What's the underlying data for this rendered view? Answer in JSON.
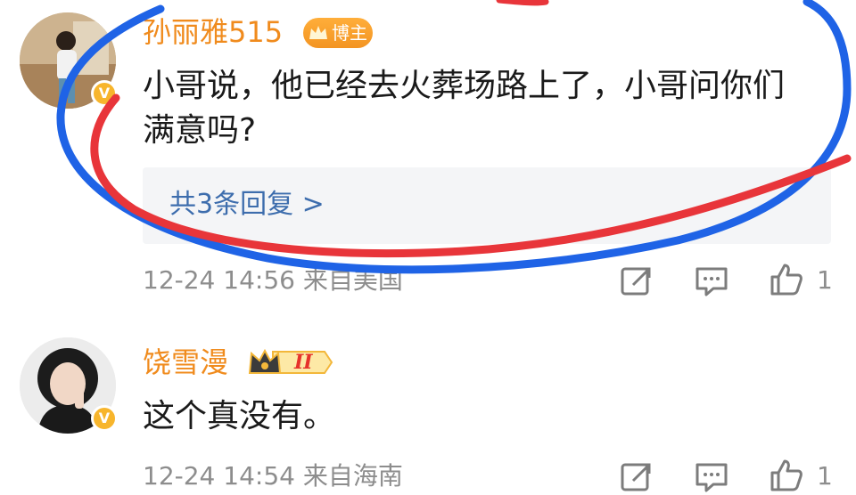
{
  "comments": [
    {
      "username": "孙丽雅515",
      "badge_label": "博主",
      "verified_mark": "V",
      "text": "小哥说，他已经去火葬场路上了，小哥问你们\n满意吗?",
      "replies_label": "共3条回复 >",
      "meta": "12-24 14:56 来自美国",
      "likes": "1",
      "icons": [
        "share-icon",
        "comment-icon",
        "like-icon"
      ]
    },
    {
      "username": "饶雪漫",
      "badge_label": "II",
      "verified_mark": "V",
      "text": "这个真没有。",
      "meta": "12-24 14:54 来自海南",
      "likes": "1",
      "icons": [
        "share-icon",
        "comment-icon",
        "like-icon"
      ]
    }
  ],
  "colors": {
    "username": "#f08b1d",
    "link": "#3d6dad",
    "meta": "#8d8d8d",
    "annotation_blue": "#1f63e6",
    "annotation_red": "#e8353a"
  }
}
